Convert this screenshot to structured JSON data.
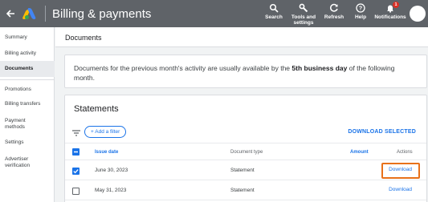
{
  "header": {
    "app_title": "Billing & payments",
    "tools": {
      "search": "Search",
      "tools_settings": "Tools and settings",
      "refresh": "Refresh",
      "help": "Help",
      "notifications": "Notifications",
      "notification_count": "1"
    }
  },
  "sidebar": {
    "items": [
      {
        "label": "Summary"
      },
      {
        "label": "Billing activity"
      },
      {
        "label": "Documents"
      },
      {
        "label": "Promotions"
      },
      {
        "label": "Billing transfers"
      },
      {
        "label": "Payment methods"
      },
      {
        "label": "Settings"
      },
      {
        "label": "Advertiser verification"
      }
    ]
  },
  "page": {
    "title": "Documents"
  },
  "info": {
    "text_before": "Documents for the previous month's activity are usually available by the ",
    "text_bold": "5th business day",
    "text_after": " of the following month."
  },
  "statements": {
    "title": "Statements",
    "add_filter": "+ Add a filter",
    "download_selected": "DOWNLOAD SELECTED",
    "columns": {
      "issue_date": "Issue date",
      "document_type": "Document type",
      "amount": "Amount",
      "actions": "Actions"
    },
    "rows": [
      {
        "issue_date": "June 30, 2023",
        "document_type": "Statement",
        "action": "Download",
        "checked": true
      },
      {
        "issue_date": "May 31, 2023",
        "document_type": "Statement",
        "action": "Download",
        "checked": false
      }
    ]
  },
  "colors": {
    "topbar": "#5f6368",
    "accent": "#1a73e8",
    "highlight": "#e8711a"
  }
}
